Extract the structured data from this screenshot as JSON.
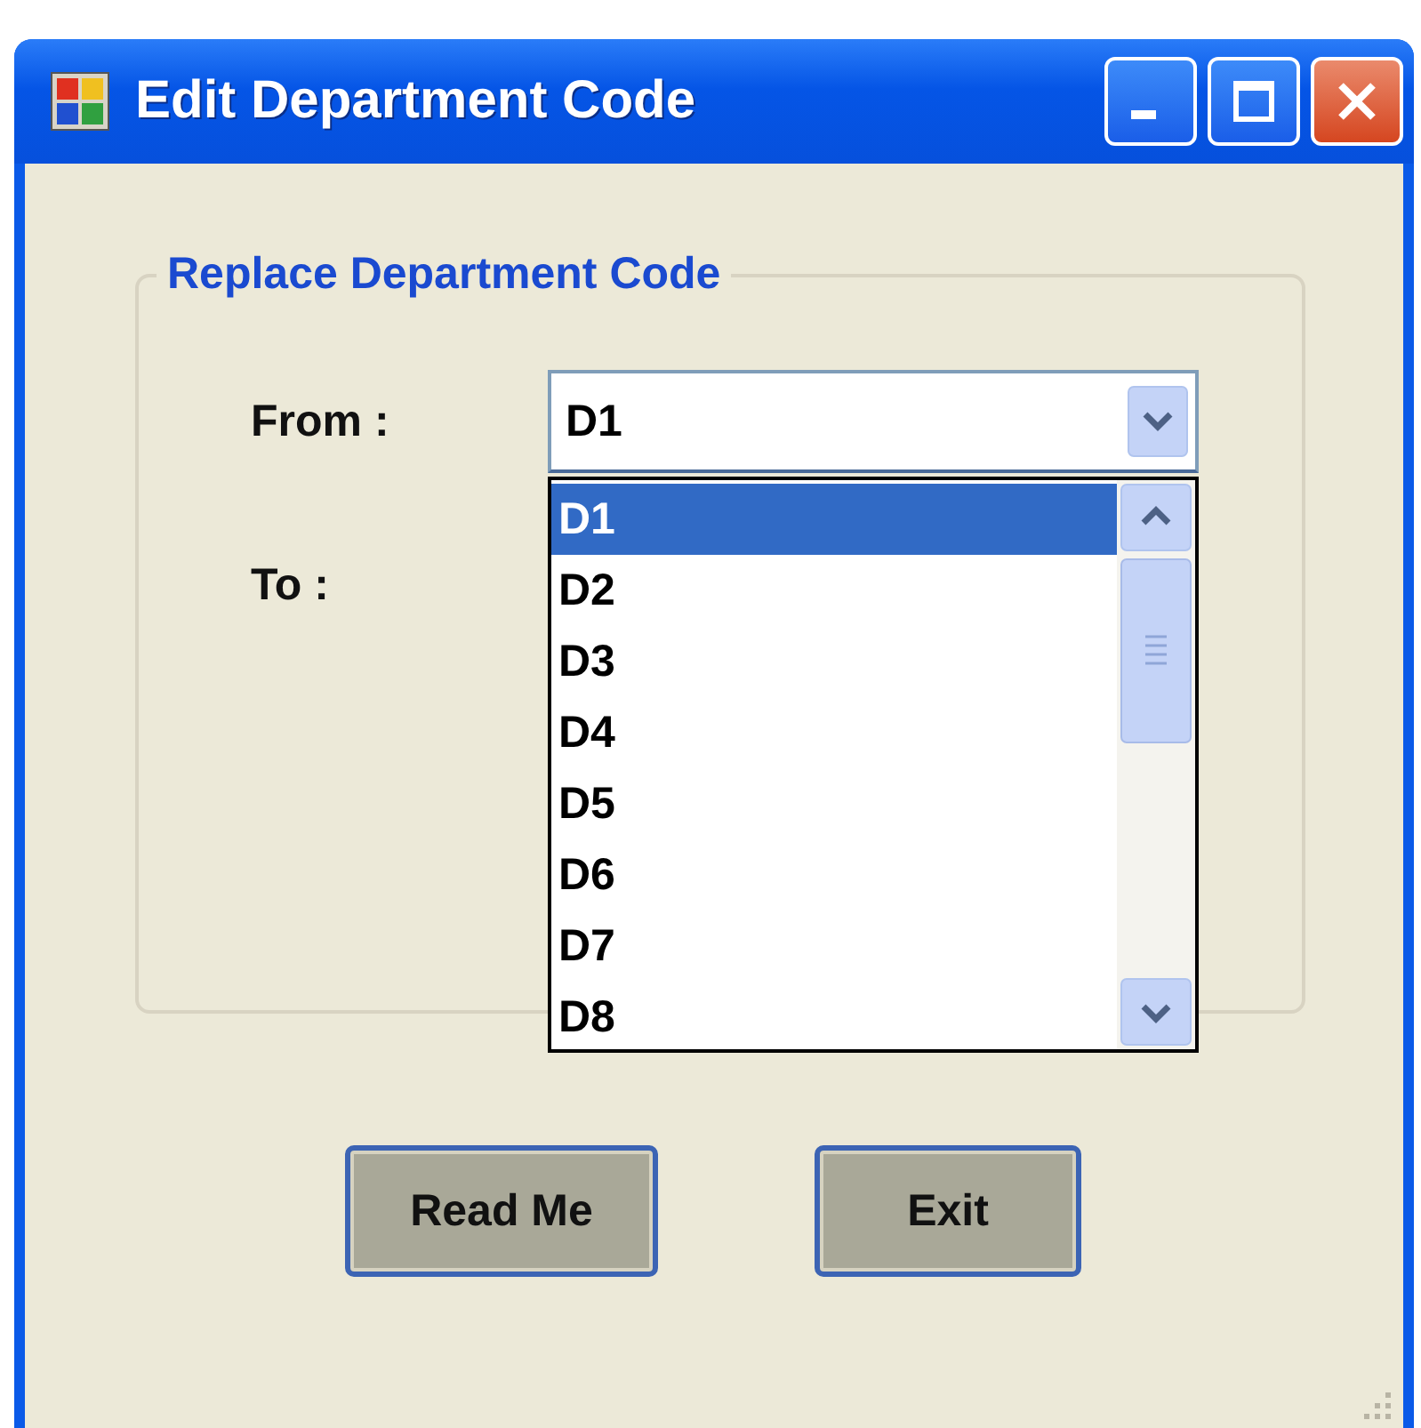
{
  "window": {
    "title": "Edit Department Code"
  },
  "group": {
    "title": "Replace Department Code"
  },
  "fields": [
    {
      "label": "From :"
    },
    {
      "label": "To :"
    }
  ],
  "from_combo": {
    "value": "D1",
    "expanded": true,
    "options": [
      {
        "label": "D1",
        "selected": true
      },
      {
        "label": "D2",
        "selected": false
      },
      {
        "label": "D3",
        "selected": false
      },
      {
        "label": "D4",
        "selected": false
      },
      {
        "label": "D5",
        "selected": false
      },
      {
        "label": "D6",
        "selected": false
      },
      {
        "label": "D7",
        "selected": false
      },
      {
        "label": "D8",
        "selected": false
      }
    ]
  },
  "buttons": [
    "Read Me",
    "Exit"
  ]
}
